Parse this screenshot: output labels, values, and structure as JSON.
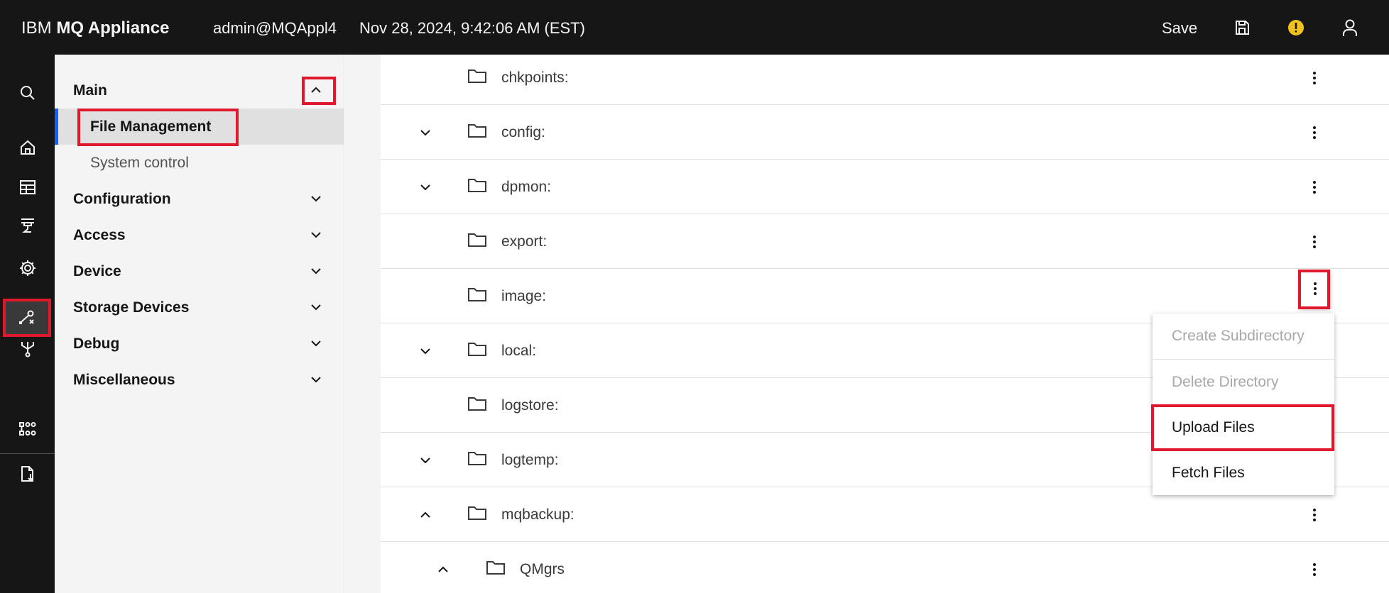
{
  "header": {
    "brand_prefix": "IBM ",
    "brand_name": "MQ Appliance",
    "user": "admin@MQAppl4",
    "datetime": "Nov 28, 2024, 9:42:06 AM (EST)",
    "save_label": "Save",
    "icons": [
      "save-icon",
      "notification-warning-icon",
      "user-icon"
    ]
  },
  "rail": {
    "icons": [
      "search-icon",
      "home-icon",
      "table-icon",
      "queue-manager-icon",
      "settings-icon",
      "monitor-icon",
      "network-icon",
      "file-tools-icon",
      "services-icon",
      "export-file-icon"
    ],
    "active": "file-tools-icon",
    "highlight_color": "#e0182d"
  },
  "sidenav": {
    "main": {
      "label": "Main",
      "expanded": true
    },
    "items": [
      {
        "label": "File Management",
        "selected": true
      },
      {
        "label": "System control",
        "selected": false
      }
    ],
    "sections": [
      "Configuration",
      "Access",
      "Device",
      "Storage Devices",
      "Debug",
      "Miscellaneous"
    ],
    "accent_color": "#0f62fe"
  },
  "files": {
    "rows": [
      {
        "name": "chkpoints:",
        "toggle": "none"
      },
      {
        "name": "config:",
        "toggle": "collapsed"
      },
      {
        "name": "dpmon:",
        "toggle": "collapsed"
      },
      {
        "name": "export:",
        "toggle": "none"
      },
      {
        "name": "image:",
        "toggle": "none"
      },
      {
        "name": "local:",
        "toggle": "collapsed"
      },
      {
        "name": "logstore:",
        "toggle": "none"
      },
      {
        "name": "logtemp:",
        "toggle": "collapsed"
      },
      {
        "name": "mqbackup:",
        "toggle": "expanded"
      },
      {
        "name": "QMgrs",
        "toggle": "expanded"
      }
    ]
  },
  "overflow_menu": {
    "items": [
      {
        "label": "Create Subdirectory",
        "disabled": true
      },
      {
        "label": "Delete Directory",
        "disabled": true
      },
      {
        "label": "Upload Files",
        "disabled": false,
        "highlighted": true
      },
      {
        "label": "Fetch Files",
        "disabled": false
      }
    ]
  }
}
